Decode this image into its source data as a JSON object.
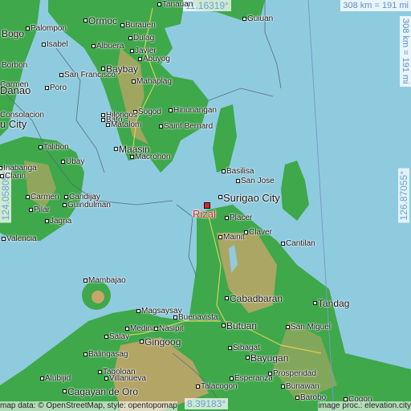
{
  "map": {
    "coordinates": {
      "north": "11.16319°",
      "south": "8.39183°",
      "west": "124.05805°",
      "east": "126.87055°"
    },
    "scale": {
      "horizontal": "308 km = 191 mi",
      "vertical": "308 km = 191 mi"
    },
    "highlight": {
      "name": "Rizal",
      "color": "#d8242c"
    },
    "places": [
      "Tanauan",
      "Ormoc",
      "Guiuan",
      "Bogo",
      "Palompon",
      "Burauen",
      "Isabel",
      "Dulag",
      "Albuera",
      "Javier",
      "Borbon",
      "Abuyog",
      "Baybay",
      "San Francisco",
      "Carmen",
      "Mahaplag",
      "Poro",
      "Danao",
      "Hinunangan",
      "Sogod",
      "Hilongos",
      "Consolacion",
      "Bato",
      "Saint Bernard",
      "Matalom",
      "u City",
      "Maasin",
      "Talibon",
      "Macrohon",
      "Ubay",
      "Basilisa",
      "Inabanga",
      "San Jose",
      "Clarin",
      "Surigao City",
      "Carmen",
      "Candijay",
      "Guindulman",
      "Pilar",
      "Placer",
      "Jagna",
      "Claver",
      "Valencia",
      "Mainit",
      "Cantilan",
      "Mambajao",
      "Cabadbaran",
      "Tandag",
      "Magsaysay",
      "Buenavista",
      "Medina",
      "Nasipit",
      "Butuan",
      "San Miguel",
      "Salay",
      "Gingoog",
      "Balingasag",
      "Sibagat",
      "Bayugan",
      "Tagoloan",
      "Villanueva",
      "Esperanza",
      "Prosperidad",
      "Alubijid",
      "Cagayan de Oro",
      "Talacogon",
      "Bunawan",
      "Barobo",
      "Cogon"
    ],
    "credit": "map data: © OpenStreetMap, style: opentopomap",
    "credit_right": "image proc.: elevation.city",
    "colors": {
      "sea": "#8fcbdf",
      "lowland": "#2e9a3a",
      "highland": "#c8a56a",
      "border": "#5a6b7a"
    }
  }
}
